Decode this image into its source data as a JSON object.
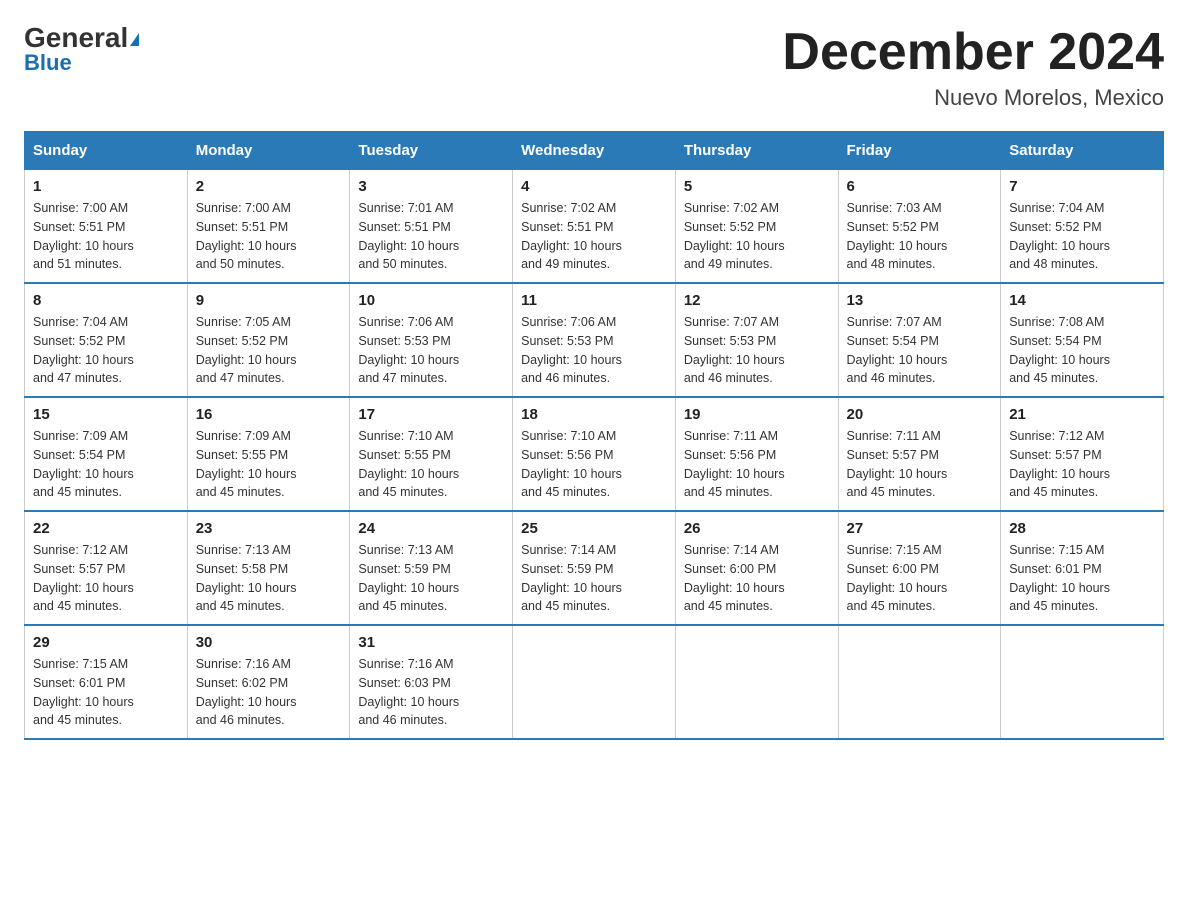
{
  "logo": {
    "general": "General",
    "blue": "Blue"
  },
  "title": "December 2024",
  "subtitle": "Nuevo Morelos, Mexico",
  "days_of_week": [
    "Sunday",
    "Monday",
    "Tuesday",
    "Wednesday",
    "Thursday",
    "Friday",
    "Saturday"
  ],
  "weeks": [
    [
      {
        "day": "1",
        "sunrise": "7:00 AM",
        "sunset": "5:51 PM",
        "daylight": "10 hours and 51 minutes."
      },
      {
        "day": "2",
        "sunrise": "7:00 AM",
        "sunset": "5:51 PM",
        "daylight": "10 hours and 50 minutes."
      },
      {
        "day": "3",
        "sunrise": "7:01 AM",
        "sunset": "5:51 PM",
        "daylight": "10 hours and 50 minutes."
      },
      {
        "day": "4",
        "sunrise": "7:02 AM",
        "sunset": "5:51 PM",
        "daylight": "10 hours and 49 minutes."
      },
      {
        "day": "5",
        "sunrise": "7:02 AM",
        "sunset": "5:52 PM",
        "daylight": "10 hours and 49 minutes."
      },
      {
        "day": "6",
        "sunrise": "7:03 AM",
        "sunset": "5:52 PM",
        "daylight": "10 hours and 48 minutes."
      },
      {
        "day": "7",
        "sunrise": "7:04 AM",
        "sunset": "5:52 PM",
        "daylight": "10 hours and 48 minutes."
      }
    ],
    [
      {
        "day": "8",
        "sunrise": "7:04 AM",
        "sunset": "5:52 PM",
        "daylight": "10 hours and 47 minutes."
      },
      {
        "day": "9",
        "sunrise": "7:05 AM",
        "sunset": "5:52 PM",
        "daylight": "10 hours and 47 minutes."
      },
      {
        "day": "10",
        "sunrise": "7:06 AM",
        "sunset": "5:53 PM",
        "daylight": "10 hours and 47 minutes."
      },
      {
        "day": "11",
        "sunrise": "7:06 AM",
        "sunset": "5:53 PM",
        "daylight": "10 hours and 46 minutes."
      },
      {
        "day": "12",
        "sunrise": "7:07 AM",
        "sunset": "5:53 PM",
        "daylight": "10 hours and 46 minutes."
      },
      {
        "day": "13",
        "sunrise": "7:07 AM",
        "sunset": "5:54 PM",
        "daylight": "10 hours and 46 minutes."
      },
      {
        "day": "14",
        "sunrise": "7:08 AM",
        "sunset": "5:54 PM",
        "daylight": "10 hours and 45 minutes."
      }
    ],
    [
      {
        "day": "15",
        "sunrise": "7:09 AM",
        "sunset": "5:54 PM",
        "daylight": "10 hours and 45 minutes."
      },
      {
        "day": "16",
        "sunrise": "7:09 AM",
        "sunset": "5:55 PM",
        "daylight": "10 hours and 45 minutes."
      },
      {
        "day": "17",
        "sunrise": "7:10 AM",
        "sunset": "5:55 PM",
        "daylight": "10 hours and 45 minutes."
      },
      {
        "day": "18",
        "sunrise": "7:10 AM",
        "sunset": "5:56 PM",
        "daylight": "10 hours and 45 minutes."
      },
      {
        "day": "19",
        "sunrise": "7:11 AM",
        "sunset": "5:56 PM",
        "daylight": "10 hours and 45 minutes."
      },
      {
        "day": "20",
        "sunrise": "7:11 AM",
        "sunset": "5:57 PM",
        "daylight": "10 hours and 45 minutes."
      },
      {
        "day": "21",
        "sunrise": "7:12 AM",
        "sunset": "5:57 PM",
        "daylight": "10 hours and 45 minutes."
      }
    ],
    [
      {
        "day": "22",
        "sunrise": "7:12 AM",
        "sunset": "5:57 PM",
        "daylight": "10 hours and 45 minutes."
      },
      {
        "day": "23",
        "sunrise": "7:13 AM",
        "sunset": "5:58 PM",
        "daylight": "10 hours and 45 minutes."
      },
      {
        "day": "24",
        "sunrise": "7:13 AM",
        "sunset": "5:59 PM",
        "daylight": "10 hours and 45 minutes."
      },
      {
        "day": "25",
        "sunrise": "7:14 AM",
        "sunset": "5:59 PM",
        "daylight": "10 hours and 45 minutes."
      },
      {
        "day": "26",
        "sunrise": "7:14 AM",
        "sunset": "6:00 PM",
        "daylight": "10 hours and 45 minutes."
      },
      {
        "day": "27",
        "sunrise": "7:15 AM",
        "sunset": "6:00 PM",
        "daylight": "10 hours and 45 minutes."
      },
      {
        "day": "28",
        "sunrise": "7:15 AM",
        "sunset": "6:01 PM",
        "daylight": "10 hours and 45 minutes."
      }
    ],
    [
      {
        "day": "29",
        "sunrise": "7:15 AM",
        "sunset": "6:01 PM",
        "daylight": "10 hours and 45 minutes."
      },
      {
        "day": "30",
        "sunrise": "7:16 AM",
        "sunset": "6:02 PM",
        "daylight": "10 hours and 46 minutes."
      },
      {
        "day": "31",
        "sunrise": "7:16 AM",
        "sunset": "6:03 PM",
        "daylight": "10 hours and 46 minutes."
      },
      null,
      null,
      null,
      null
    ]
  ],
  "labels": {
    "sunrise": "Sunrise:",
    "sunset": "Sunset:",
    "daylight": "Daylight:"
  }
}
